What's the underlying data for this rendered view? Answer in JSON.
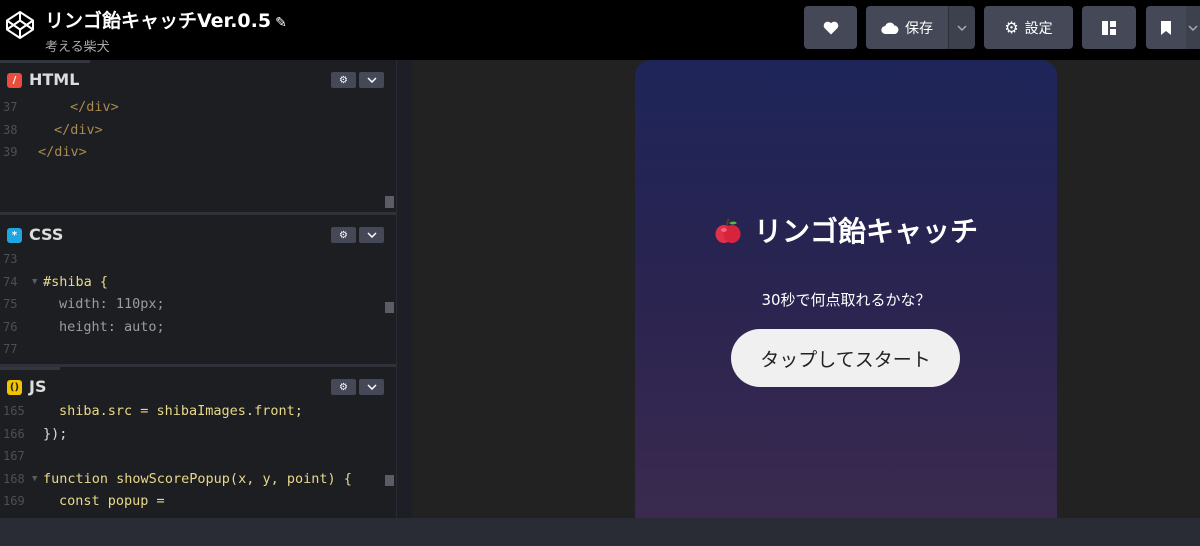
{
  "header": {
    "title": "リンゴ飴キャッチVer.0.5",
    "author": "考える柴犬",
    "save_label": "保存",
    "settings_label": "設定"
  },
  "panes": {
    "html": {
      "name": "HTML",
      "lines": [
        {
          "n": "37",
          "indent": "    ",
          "code": "</div>"
        },
        {
          "n": "38",
          "indent": "  ",
          "code": "</div>"
        },
        {
          "n": "39",
          "indent": "",
          "code": "</div>"
        }
      ]
    },
    "css": {
      "name": "CSS",
      "lines": [
        {
          "n": "73",
          "code": ""
        },
        {
          "n": "74",
          "code": "#shiba {"
        },
        {
          "n": "75",
          "code": "width: 110px;"
        },
        {
          "n": "76",
          "code": "height: auto;"
        },
        {
          "n": "77",
          "code": ""
        }
      ]
    },
    "js": {
      "name": "JS",
      "lines": [
        {
          "n": "165",
          "code": "shiba.src = shibaImages.front;"
        },
        {
          "n": "166",
          "code": "});"
        },
        {
          "n": "167",
          "code": ""
        },
        {
          "n": "168",
          "code": "function showScorePopup(x, y, point) {"
        },
        {
          "n": "169",
          "code": "const popup ="
        }
      ]
    }
  },
  "preview": {
    "game_title": "リンゴ飴キャッチ",
    "subtitle": "30秒で何点取れるかな？",
    "start_button": "タップしてスタート"
  },
  "colors": {
    "html_icon": "#e84d3d",
    "css_icon": "#1ea6e0",
    "js_icon": "#f2c300",
    "card_top": "#1e2559",
    "card_bottom": "#3a2a4f"
  },
  "icons": [
    "codepen-logo-icon",
    "pencil-icon",
    "heart-icon",
    "cloud-icon",
    "chevron-down-icon",
    "gear-icon",
    "layout-icon",
    "bookmark-icon",
    "apple-icon"
  ]
}
